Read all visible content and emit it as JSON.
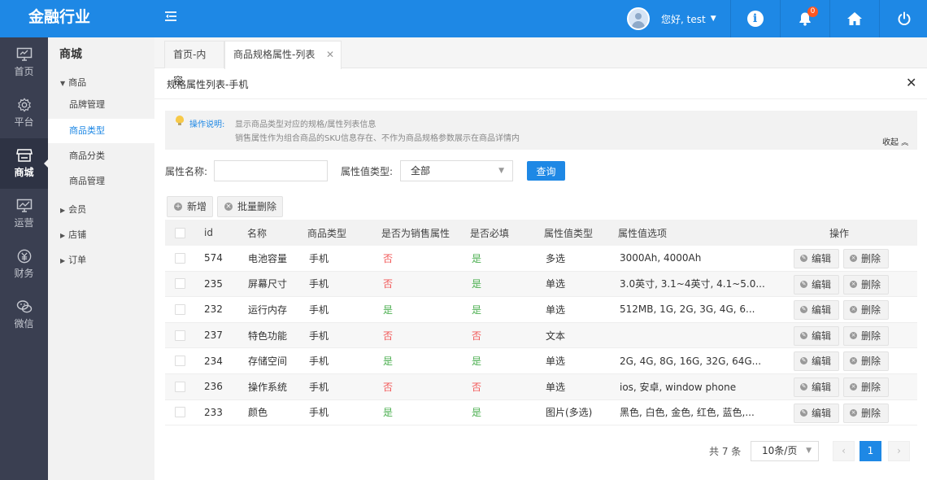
{
  "app": {
    "title": "金融行业"
  },
  "header": {
    "user_name": "您好, test",
    "notification_count": "0"
  },
  "nav": [
    {
      "label": "首页",
      "icon": "monitor-icon"
    },
    {
      "label": "平台",
      "icon": "gear-icon"
    },
    {
      "label": "商城",
      "icon": "store-icon"
    },
    {
      "label": "运营",
      "icon": "screen-chart-icon"
    },
    {
      "label": "财务",
      "icon": "money-icon"
    },
    {
      "label": "微信",
      "icon": "wechat-icon"
    }
  ],
  "submenu": {
    "title": "商城",
    "group_goods": "商品",
    "items": [
      "品牌管理",
      "商品类型",
      "商品分类",
      "商品管理"
    ],
    "group_member": "会员",
    "group_store": "店铺",
    "group_order": "订单"
  },
  "tabs": {
    "home": "首页-内容",
    "active": "商品规格属性-列表"
  },
  "panel": {
    "title": "规格属性列表-手机"
  },
  "info": {
    "label": "操作说明:",
    "line1": "显示商品类型对应的规格/属性列表信息",
    "line2": "销售属性作为组合商品的SKU信息存在、不作为商品规格参数展示在商品详情内",
    "collapse": "收起"
  },
  "search": {
    "name_label": "属性名称:",
    "name_value": "",
    "type_label": "属性值类型:",
    "type_value": "全部",
    "query": "查询"
  },
  "toolbar": {
    "add": "新增",
    "batch_delete": "批量删除"
  },
  "table": {
    "headers": [
      "id",
      "名称",
      "商品类型",
      "是否为销售属性",
      "是否必填",
      "属性值类型",
      "属性值选项",
      "操作"
    ],
    "edit_label": "编辑",
    "delete_label": "删除",
    "rows": [
      {
        "id": "574",
        "name": "电池容量",
        "type": "手机",
        "sale": "否",
        "required": "是",
        "value_type": "多选",
        "options": "3000Ah, 4000Ah"
      },
      {
        "id": "235",
        "name": "屏幕尺寸",
        "type": "手机",
        "sale": "否",
        "required": "是",
        "value_type": "单选",
        "options": "3.0英寸, 3.1~4英寸, 4.1~5.0..."
      },
      {
        "id": "232",
        "name": "运行内存",
        "type": "手机",
        "sale": "是",
        "required": "是",
        "value_type": "单选",
        "options": "512MB, 1G, 2G, 3G, 4G, 6..."
      },
      {
        "id": "237",
        "name": "特色功能",
        "type": "手机",
        "sale": "否",
        "required": "否",
        "value_type": "文本",
        "options": ""
      },
      {
        "id": "234",
        "name": "存储空间",
        "type": "手机",
        "sale": "是",
        "required": "是",
        "value_type": "单选",
        "options": "2G, 4G, 8G, 16G, 32G, 64G..."
      },
      {
        "id": "236",
        "name": "操作系统",
        "type": "手机",
        "sale": "否",
        "required": "否",
        "value_type": "单选",
        "options": "ios, 安卓, window phone"
      },
      {
        "id": "233",
        "name": "颜色",
        "type": "手机",
        "sale": "是",
        "required": "是",
        "value_type": "图片(多选)",
        "options": "黑色, 白色, 金色, 红色, 蓝色,..."
      }
    ]
  },
  "pagination": {
    "total": "共 7 条",
    "page_size": "10条/页",
    "current": "1",
    "prev": "‹",
    "next": "›"
  },
  "colors": {
    "primary": "#1e88e5",
    "yes": "#4caf50",
    "no": "#f25757",
    "sidebar": "#3a3f51"
  }
}
